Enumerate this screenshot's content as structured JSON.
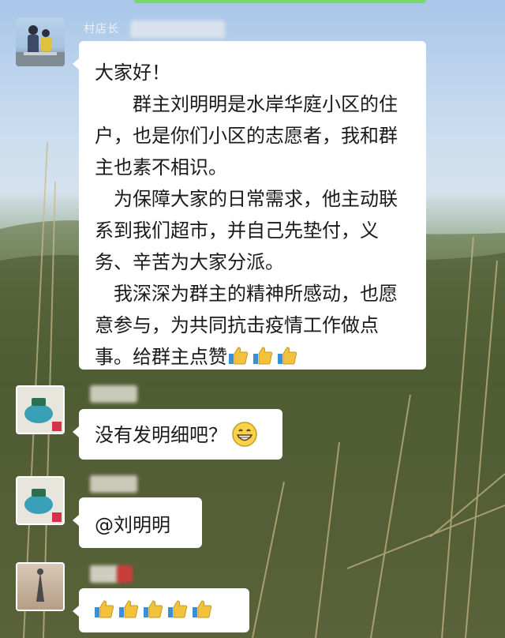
{
  "chat": {
    "messages": [
      {
        "sender": "村店长",
        "greeting": "大家好！",
        "para1": "群主刘明明是水岸华庭小区的住户，也是你们小区的志愿者，我和群主也素不相识。",
        "para2": "为保障大家的日常需求，他主动联系到我们超市，并自己先垫付，义务、辛苦为大家分派。",
        "para3": "我深深为群主的精神所感动，也愿意参与，为共同抗击疫情工作做点事。给群主点赞",
        "trailing_icons": [
          "thumbs-up-icon",
          "thumbs-up-icon",
          "thumbs-up-icon"
        ]
      },
      {
        "text": "没有发明细吧？",
        "trailing_icon": "grinning-face-icon"
      },
      {
        "text": "@刘明明"
      },
      {
        "icons": [
          "thumbs-up-icon",
          "thumbs-up-icon",
          "thumbs-up-icon",
          "thumbs-up-icon",
          "thumbs-up-icon"
        ]
      }
    ]
  }
}
